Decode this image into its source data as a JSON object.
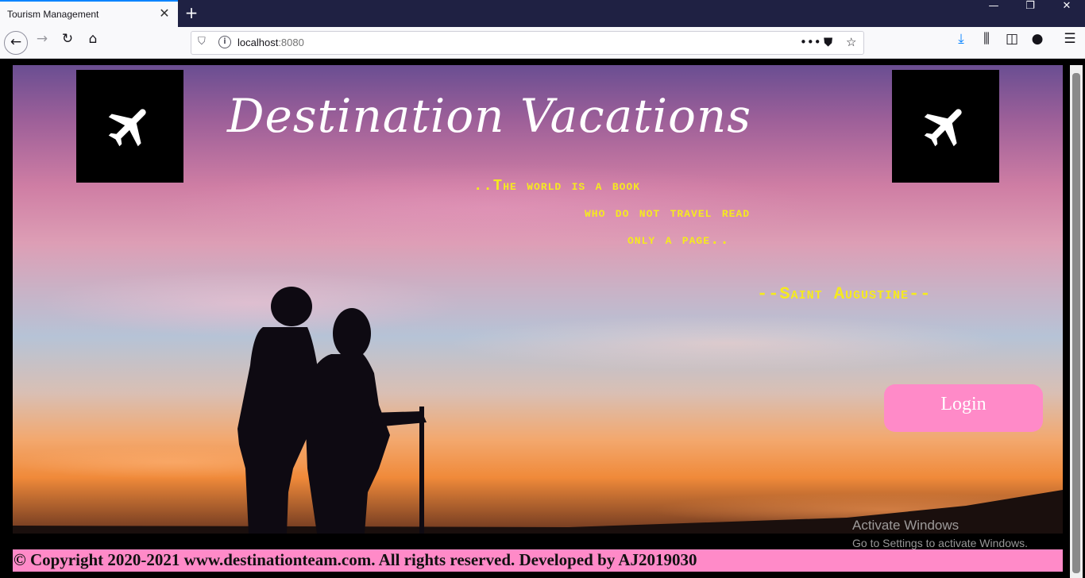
{
  "browser": {
    "tab_title": "Tourism Management",
    "tab_close": "✕",
    "new_tab": "+",
    "minimize": "—",
    "restore": "❐",
    "close": "✕",
    "url_host": "localhost",
    "url_port": ":8080"
  },
  "page": {
    "title": "Destination Vacations",
    "quote_line1": "..The world is a book",
    "quote_line2": "who do not travel read",
    "quote_line3": "only a page..",
    "quote_author": "--Saint Augustine--",
    "login_label": "Login",
    "footer": "© Copyright 2020-2021 www.destinationteam.com. All rights reserved. Developed by AJ2019030"
  },
  "os_watermark": {
    "line1": "Activate Windows",
    "line2": "Go to Settings to activate Windows."
  },
  "colors": {
    "quote": "#f5ea1f",
    "login_bg": "#ff8ac8",
    "footer_bg": "#ff8ac8",
    "tabbar_bg": "#1f2143"
  }
}
